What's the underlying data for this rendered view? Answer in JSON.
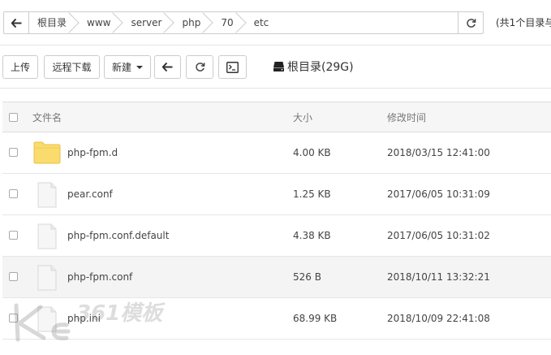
{
  "pathbar": {
    "back_icon": "arrow-left-icon",
    "crumbs": [
      "根目录",
      "www",
      "server",
      "php",
      "70",
      "etc"
    ],
    "refresh_icon": "refresh-icon"
  },
  "summary": "(共1个目录与",
  "toolbar": {
    "upload": "上传",
    "remote_download": "远程下载",
    "new": "新建",
    "back_icon": "arrow-left-icon",
    "refresh_icon": "refresh-icon",
    "terminal_icon": "terminal-icon",
    "disk_label": "根目录(29G)",
    "disk_icon": "hard-drive-icon"
  },
  "table": {
    "headers": {
      "name": "文件名",
      "size": "大小",
      "modified": "修改时间"
    },
    "rows": [
      {
        "name": "php-fpm.d",
        "size": "4.00 KB",
        "modified": "2018/03/15 12:41:00",
        "icon": "folder-icon"
      },
      {
        "name": "pear.conf",
        "size": "1.25 KB",
        "modified": "2017/06/05 10:31:09",
        "icon": "file-icon"
      },
      {
        "name": "php-fpm.conf.default",
        "size": "4.38 KB",
        "modified": "2017/06/05 10:31:02",
        "icon": "file-icon"
      },
      {
        "name": "php-fpm.conf",
        "size": "526 B",
        "modified": "2018/10/11 13:32:21",
        "icon": "file-icon"
      },
      {
        "name": "php.ini",
        "size": "68.99 KB",
        "modified": "2018/10/09 22:41:08",
        "icon": "file-icon"
      }
    ]
  },
  "watermark": "KE 361模板",
  "colors": {
    "folder": "#FADB6E",
    "file": "#F5F5F5",
    "border": "#CCCCCC",
    "alt_row": "#F4F4F4"
  }
}
